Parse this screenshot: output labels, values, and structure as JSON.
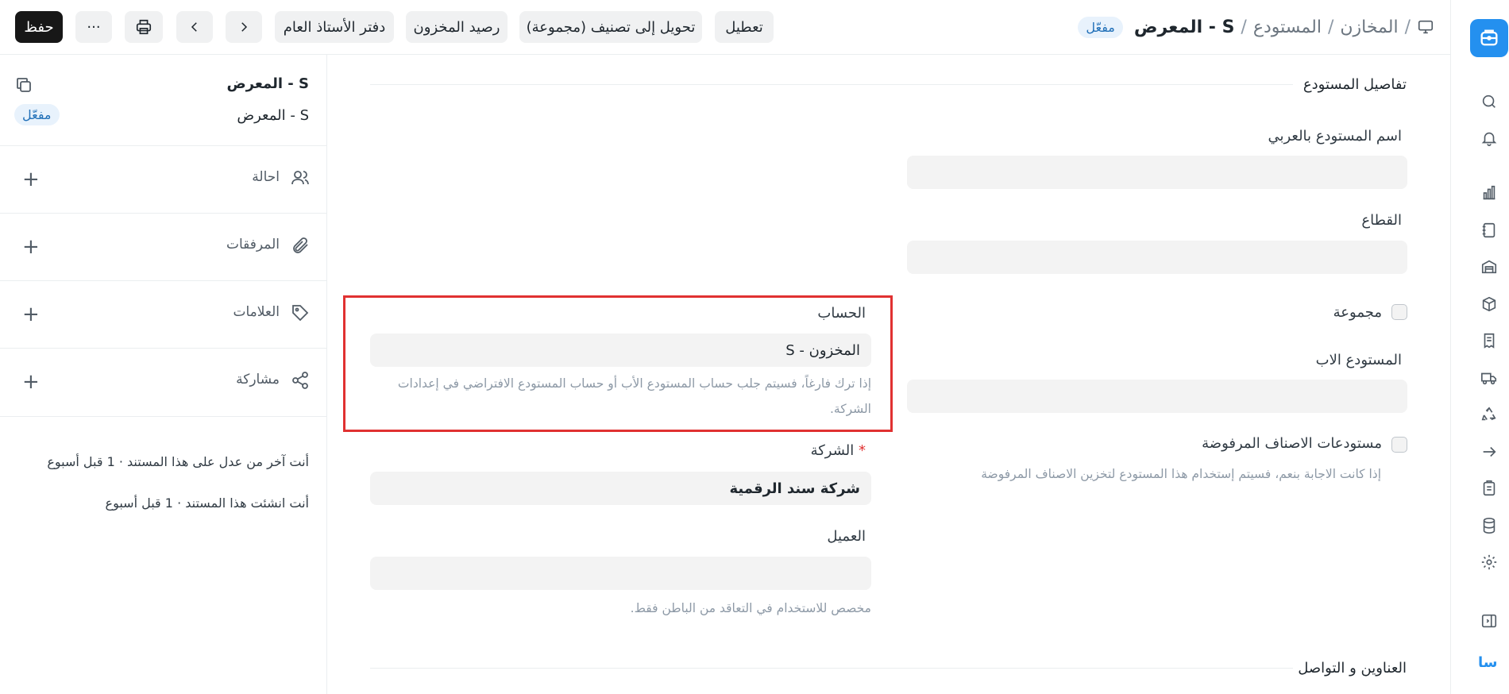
{
  "breadcrumb": {
    "items": [
      "المخازن",
      "المستودع"
    ],
    "current": "المعرض - S",
    "status_badge": "مفعّل"
  },
  "toolbar": {
    "disable": "تعطيل",
    "convert_group": "تحويل إلى تصنيف (مجموعة)",
    "stock_balance": "رصيد المخزون",
    "general_ledger": "دفتر الأستاذ العام",
    "save": "حفظ",
    "more": "···"
  },
  "sidebar": {
    "title": "المعرض - S",
    "subtitle": "المعرض - S",
    "status_badge": "مفعّل",
    "rows": {
      "assign": "احالة",
      "attachments": "المرفقات",
      "tags": "العلامات",
      "share": "مشاركة"
    },
    "activity": [
      "أنت آخر من عدل على هذا المستند · 1 قبل أسبوع",
      "أنت انشئت هذا المستند · 1 قبل أسبوع"
    ]
  },
  "form": {
    "section_details": "تفاصيل المستودع",
    "warehouse_name_ar": {
      "label": "اسم المستودع بالعربي",
      "value": ""
    },
    "sector": {
      "label": "القطاع",
      "value": ""
    },
    "is_group": {
      "label": "مجموعة",
      "checked": false
    },
    "parent_warehouse": {
      "label": "المستودع الاب",
      "value": ""
    },
    "rejected_warehouses": {
      "label": "مستودعات الاصناف المرفوضة",
      "checked": false,
      "help": "إذا كانت الاجابة بنعم، فسيتم إستخدام هذا المستودع لتخزين الاصناف المرفوضة"
    },
    "account": {
      "label": "الحساب",
      "value": "المخزون - S",
      "help": "إذا ترك فارغاً، فسيتم جلب حساب المستودع الأب أو حساب المستودع الافتراضي في إعدادات الشركة."
    },
    "company": {
      "label": "الشركة",
      "required_mark": "*",
      "value": "شركة سند الرقمية"
    },
    "customer": {
      "label": "العميل",
      "value": "",
      "help": "مخصص للاستخدام في التعاقد من الباطن فقط."
    },
    "section_addresses": "العناوين و التواصل"
  },
  "rail": {
    "user_initials": "سا",
    "icons": [
      "app-logo-icon",
      "search-icon",
      "bell-icon",
      "chart-icon",
      "notebook-icon",
      "warehouse-icon",
      "package-icon",
      "receipt-icon",
      "truck-icon",
      "recycle-icon",
      "arrow-right-icon",
      "clipboard-icon",
      "database-icon",
      "gear-icon",
      "sidebar-toggle-icon"
    ]
  },
  "colors": {
    "accent": "#2490ef",
    "badge_bg": "#e8f2fc",
    "badge_text": "#2170b8",
    "highlight": "#e03131"
  }
}
